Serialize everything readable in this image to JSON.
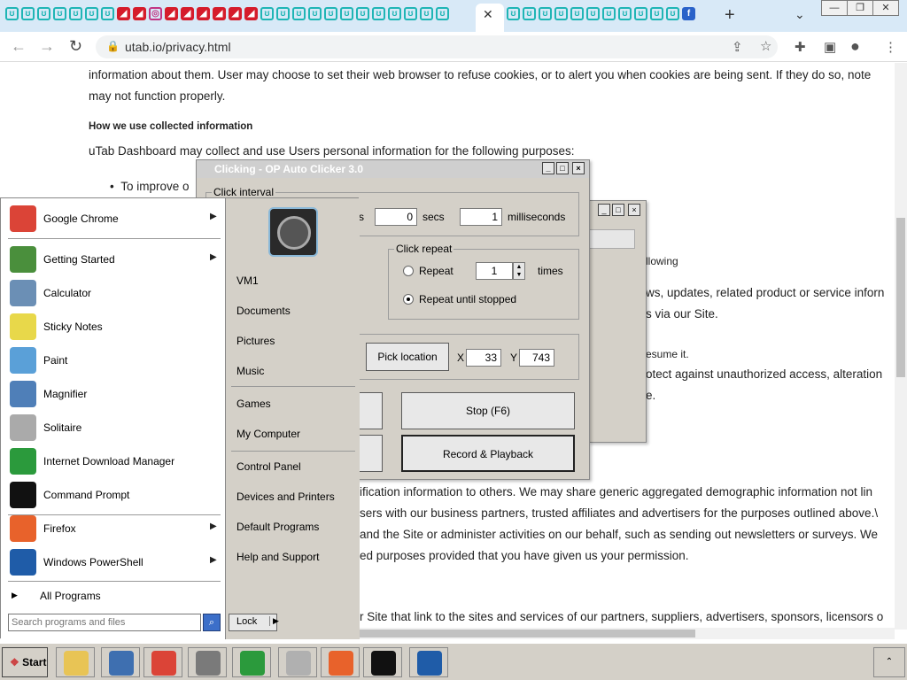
{
  "browser": {
    "tab_close": "✕",
    "new_tab": "+",
    "tab_menu": "⌄",
    "window_buttons": [
      "—",
      "❐",
      "✕"
    ],
    "url": "utab.io/privacy.html",
    "nav": {
      "back": "←",
      "forward": "→",
      "reload": "↻"
    }
  },
  "page": {
    "line1": "information about them. User may choose to set their web browser to refuse cookies, or to alert you when cookies are being sent. If they do so, note",
    "line2": "may not function properly.",
    "heading": "How we use collected information",
    "line3": "uTab Dashboard may collect and use Users personal information for the following purposes:",
    "bullet1": "To improve o",
    "frag_following": "llowing",
    "frag_news": "ws, updates, related product or service inforn",
    "frag_site": "s via our Site.",
    "frag_resume": "esume it.",
    "frag_protect": "otect against unauthorized access, alteration",
    "frag_e": "e.",
    "frag_share": "ification information to others. We may share generic aggregated demographic information not lin",
    "frag_partners": "sers with our business partners, trusted affiliates and advertisers for the purposes outlined above.\\",
    "frag_admin": "and the Site or administer activities on our behalf, such as sending out newsletters or surveys. We",
    "frag_permission": "ed purposes provided that you have given us your permission.",
    "frag_links": "r Site that link to the sites and services of our partners, suppliers, advertisers, sponsors, licensors o"
  },
  "clicker": {
    "title": "Clicking - OP Auto Clicker 3.0",
    "interval_label": "Click interval",
    "frag_s": "s",
    "secs_value": "0",
    "secs_label": "secs",
    "ms_value": "1",
    "ms_label": "milliseconds",
    "repeat_group": "Click repeat",
    "repeat_label": "Repeat",
    "repeat_count": "1",
    "times_label": "times",
    "until_stopped_label": "Repeat until stopped",
    "pick_location": "Pick location",
    "x_label": "X",
    "x_value": "33",
    "y_label": "Y",
    "y_value": "743",
    "stop_button": "Stop (F6)",
    "record_button": "Record & Playback"
  },
  "startmenu": {
    "programs": [
      {
        "label": "Google Chrome",
        "arrow": true,
        "color": "#db4437"
      },
      {
        "label": "Getting Started",
        "arrow": true,
        "color": "#4a8f3c"
      },
      {
        "label": "Calculator",
        "arrow": false,
        "color": "#6b8fb5"
      },
      {
        "label": "Sticky Notes",
        "arrow": false,
        "color": "#e8d84a"
      },
      {
        "label": "Paint",
        "arrow": false,
        "color": "#5aa0d8"
      },
      {
        "label": "Magnifier",
        "arrow": false,
        "color": "#4f7fb8"
      },
      {
        "label": "Solitaire",
        "arrow": false,
        "color": "#aaaaaa"
      },
      {
        "label": "Internet Download Manager",
        "arrow": false,
        "color": "#2b9a3c"
      },
      {
        "label": "Command Prompt",
        "arrow": false,
        "color": "#111111"
      },
      {
        "label": "Firefox",
        "arrow": true,
        "color": "#e8622b"
      },
      {
        "label": "Windows PowerShell",
        "arrow": true,
        "color": "#1f5ca8"
      }
    ],
    "all_programs": "All Programs",
    "right_items": [
      "VM1",
      "Documents",
      "Pictures",
      "Music",
      "Games",
      "My Computer",
      "Control Panel",
      "Devices and Printers",
      "Default Programs",
      "Help and Support"
    ],
    "search_placeholder": "Search programs and files",
    "lock_label": "Lock"
  },
  "taskbar": {
    "start_label": "Start",
    "tray": "⌃",
    "apps": [
      {
        "name": "explorer",
        "color": "#e8c455"
      },
      {
        "name": "media-player",
        "color": "#3e6fb0"
      },
      {
        "name": "chrome",
        "color": "#db4437"
      },
      {
        "name": "server-manager",
        "color": "#7a7a7a"
      },
      {
        "name": "idm",
        "color": "#2b9a3c"
      },
      {
        "name": "mouse",
        "color": "#b0b0b0"
      },
      {
        "name": "firefox",
        "color": "#e8622b"
      },
      {
        "name": "cmd",
        "color": "#111111"
      },
      {
        "name": "powershell",
        "color": "#1f5ca8"
      }
    ]
  }
}
